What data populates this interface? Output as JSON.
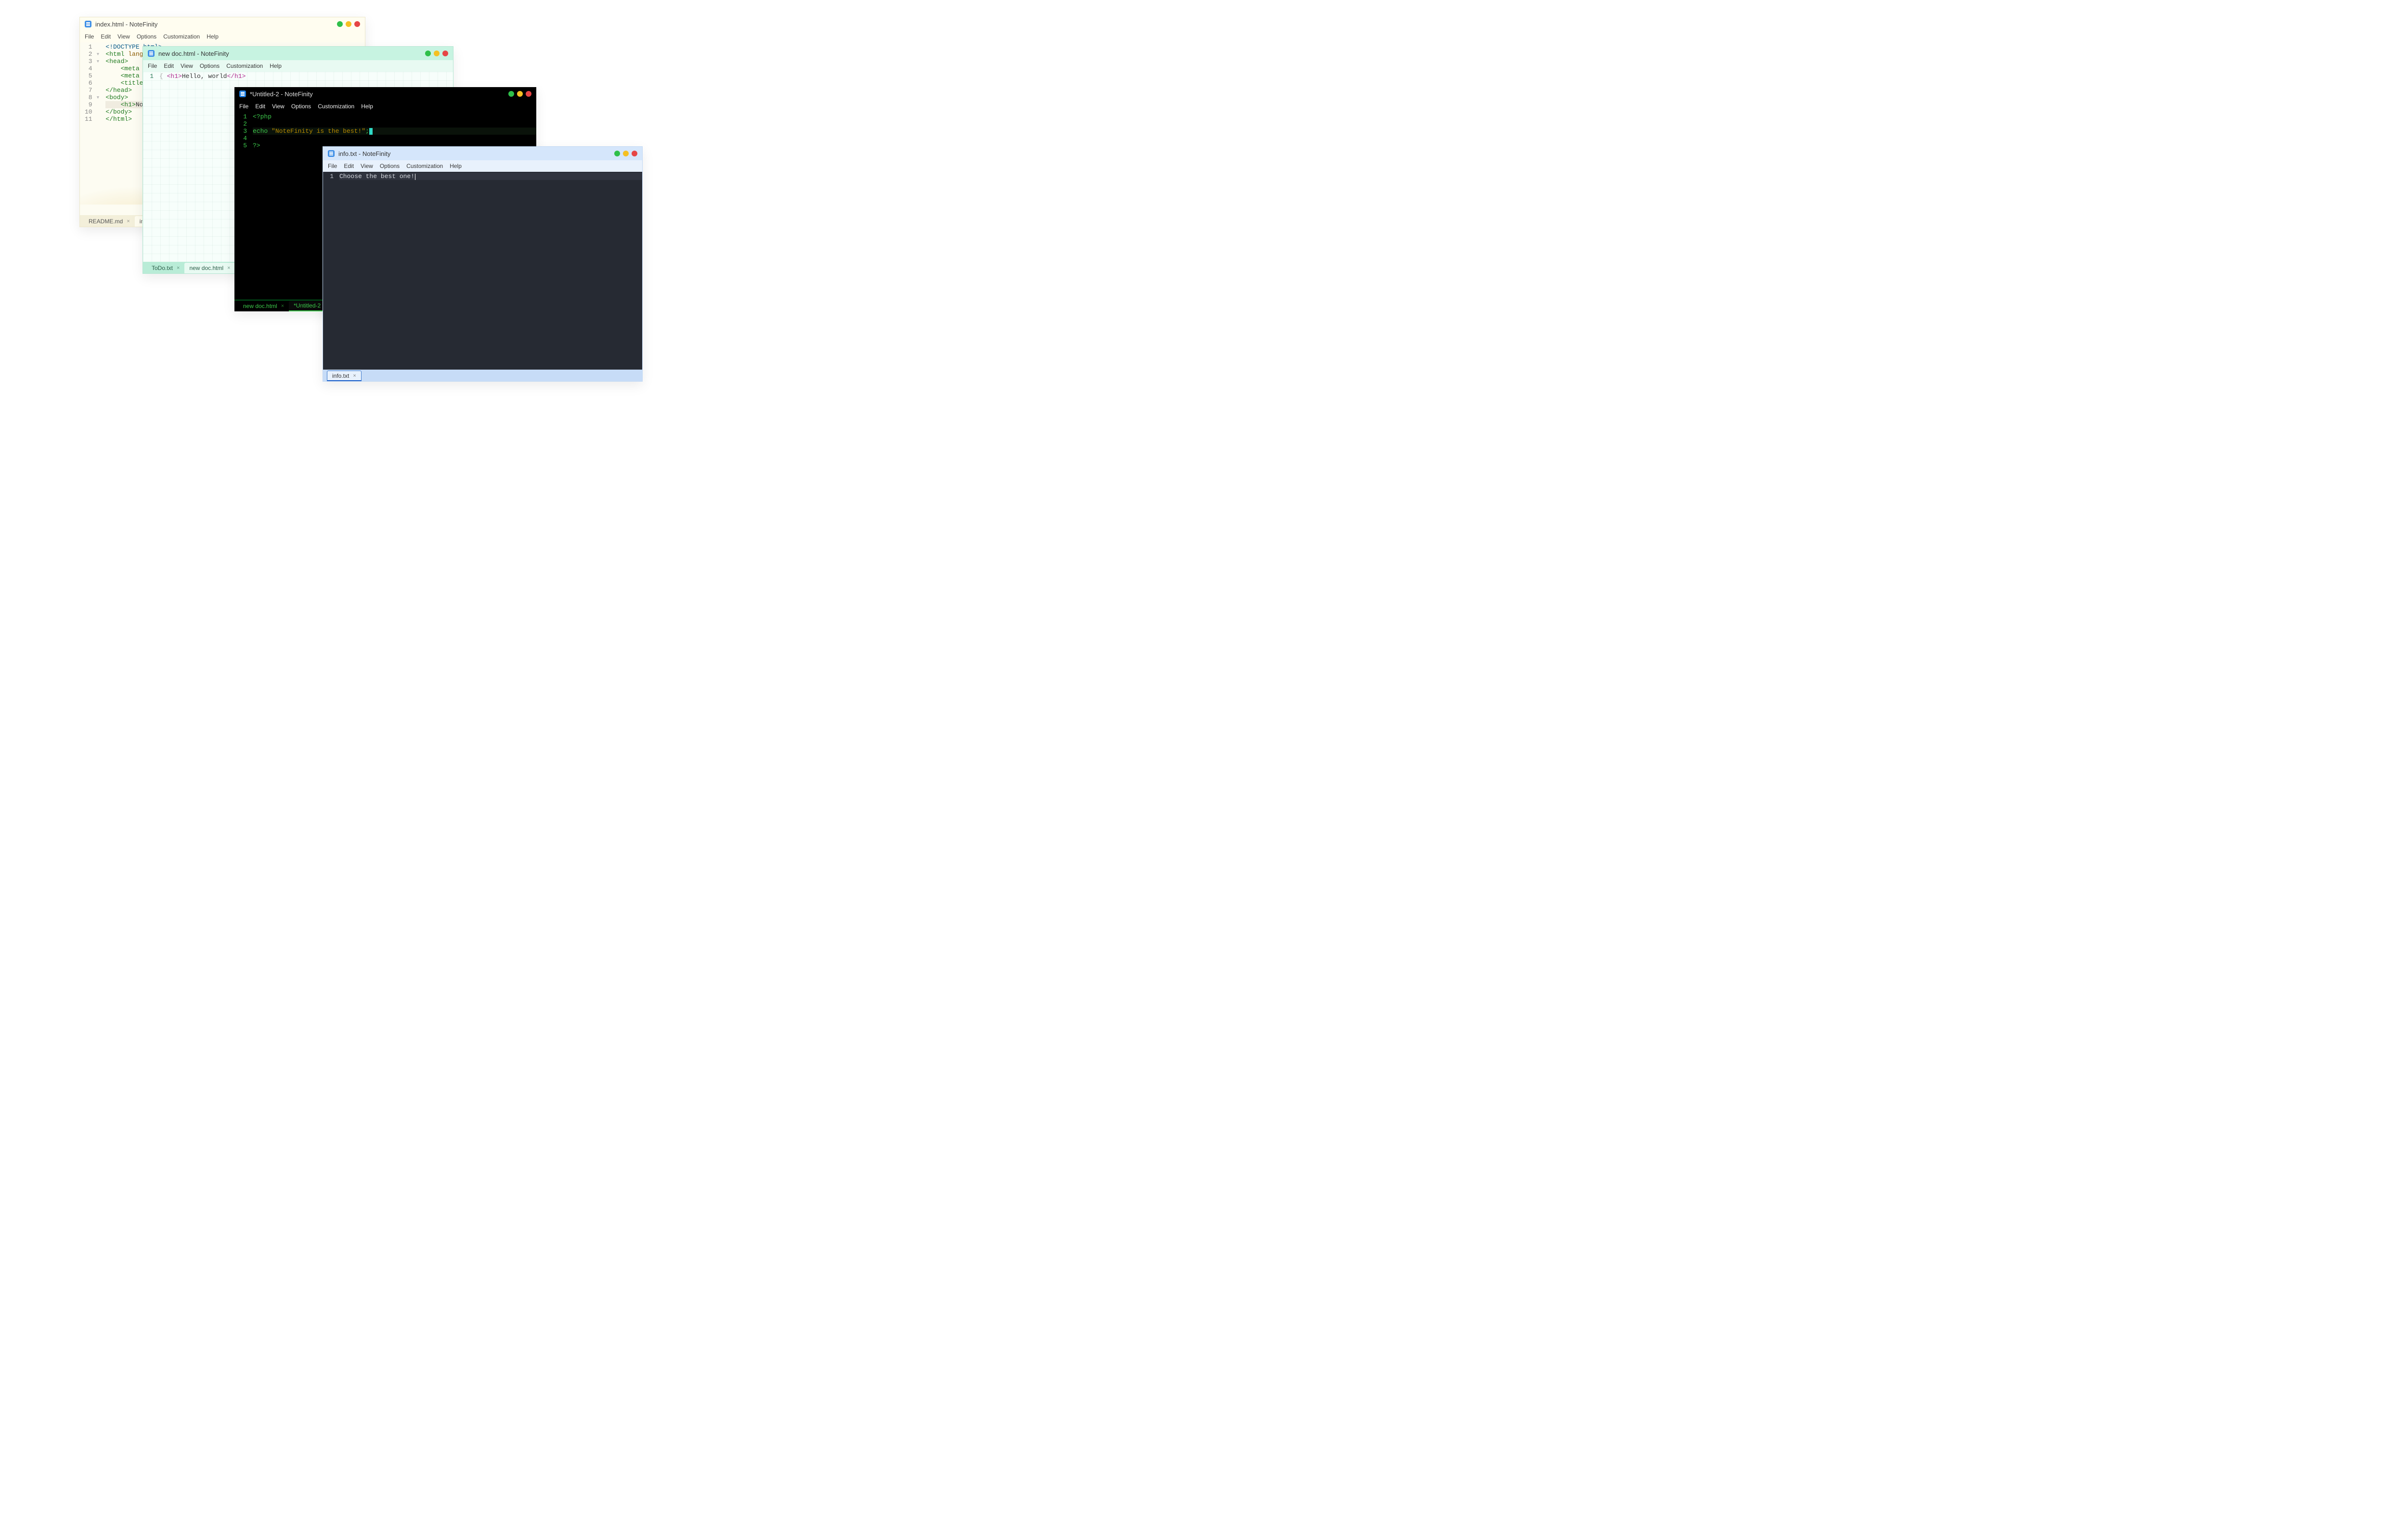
{
  "app_name": "NoteFinity",
  "menu": {
    "file": "File",
    "edit": "Edit",
    "view": "View",
    "options": "Options",
    "customization": "Customization",
    "help": "Help"
  },
  "lights": {
    "green": "#2fbf4a",
    "yellow": "#f5c023",
    "red": "#e64545"
  },
  "w1": {
    "title": "index.html  -  NoteFinity",
    "lines": [
      {
        "n": "1",
        "fold": "",
        "html": "<span class='type'>&lt;!DOCTYPE html&gt;</span>"
      },
      {
        "n": "2",
        "fold": "▾",
        "html": "<span class='tag'>&lt;html</span> <span class='attr'>lang</span>=<span class='str'>\"en</span>"
      },
      {
        "n": "3",
        "fold": "▾",
        "html": "<span class='tag'>&lt;head&gt;</span>"
      },
      {
        "n": "4",
        "fold": "",
        "html": "    <span class='tag'>&lt;meta</span> <span class='attr'>cha</span>"
      },
      {
        "n": "5",
        "fold": "",
        "html": "    <span class='tag'>&lt;meta</span> <span class='attr'>nam</span>"
      },
      {
        "n": "6",
        "fold": "",
        "html": "    <span class='tag'>&lt;title&gt;</span>Doc"
      },
      {
        "n": "7",
        "fold": "",
        "html": "<span class='tag'>&lt;/head&gt;</span>"
      },
      {
        "n": "8",
        "fold": "▾",
        "html": "<span class='tag'>&lt;body&gt;</span>"
      },
      {
        "n": "9",
        "fold": "",
        "hl": true,
        "html": "    <span class='tag'>&lt;h1&gt;</span>NoteF"
      },
      {
        "n": "10",
        "fold": "",
        "html": "<span class='tag'>&lt;/body&gt;</span>"
      },
      {
        "n": "11",
        "fold": "",
        "html": "<span class='tag'>&lt;/html&gt;</span>"
      }
    ],
    "tabs": [
      {
        "label": "README.md",
        "active": false
      },
      {
        "label": "index.",
        "active": true
      }
    ]
  },
  "w2": {
    "title": "new doc.html  -  NoteFinity",
    "lines": [
      {
        "n": "1",
        "html": "<span class='tag'>&lt;h1&gt;</span>Hello, world<span class='tag'>&lt;/h1&gt;</span>",
        "prefix": "{"
      }
    ],
    "tabs": [
      {
        "label": "ToDo.txt",
        "active": false
      },
      {
        "label": "new doc.html",
        "active": true
      }
    ]
  },
  "w3": {
    "title": "*Untitled-2  -  NoteFinity",
    "lines": [
      {
        "n": "1",
        "html": "&lt;?php"
      },
      {
        "n": "2",
        "html": ""
      },
      {
        "n": "3",
        "hl": true,
        "html": "echo <span class='str'>\"NoteFinity is the best!\"</span>;<span class='cursor'></span>"
      },
      {
        "n": "4",
        "html": ""
      },
      {
        "n": "5",
        "html": "?&gt;"
      }
    ],
    "tabs": [
      {
        "label": "new doc.html",
        "active": false
      },
      {
        "label": "*Untitled-2",
        "active": true
      }
    ]
  },
  "w4": {
    "title": "info.txt  -  NoteFinity",
    "lines": [
      {
        "n": "1",
        "hl": true,
        "html": "Choose the best one!<span class='caret'></span>"
      }
    ],
    "tabs": [
      {
        "label": "info.txt",
        "active": true
      }
    ]
  }
}
